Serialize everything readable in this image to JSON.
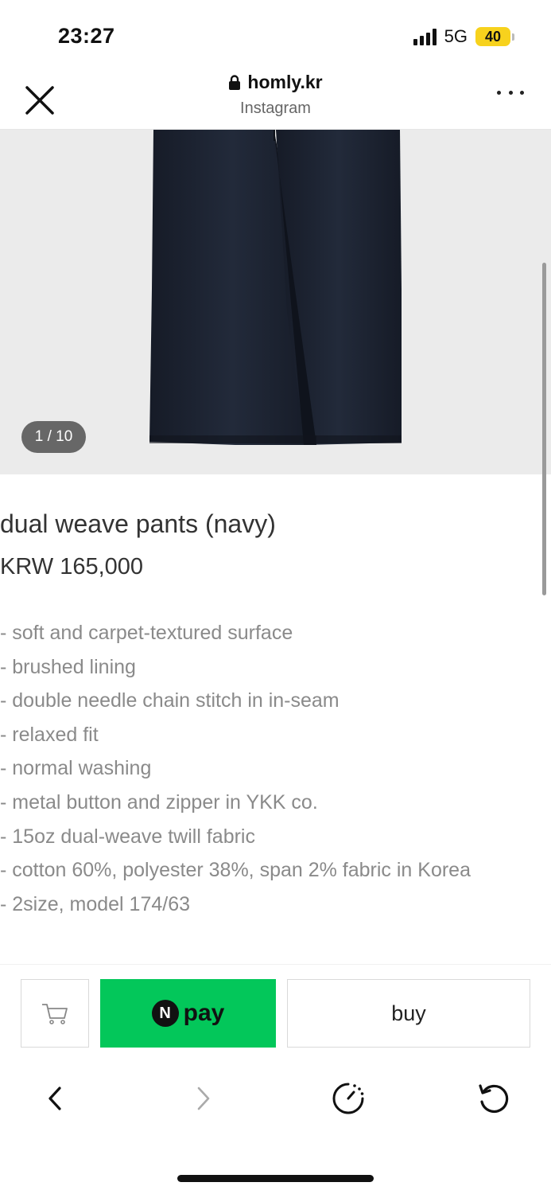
{
  "status": {
    "time": "23:27",
    "network": "5G",
    "battery": "40"
  },
  "browser": {
    "domain": "homly.kr",
    "subtitle": "Instagram",
    "close_icon": "close-icon",
    "more_icon": "more-dots-icon",
    "lock_icon": "lock-icon"
  },
  "product": {
    "image_counter": "1 / 10",
    "name": "dual weave pants (navy)",
    "price": "KRW 165,000",
    "features": [
      "- soft and carpet-textured surface",
      "- brushed lining",
      "- double needle chain stitch in in-seam",
      "- relaxed fit",
      "- normal washing",
      "- metal button and zipper in YKK co.",
      "- 15oz dual-weave twill fabric",
      "- cotton 60%, polyester 38%, span 2% fabric in Korea",
      "- 2size, model 174/63"
    ]
  },
  "purchase": {
    "cart_icon": "cart-icon",
    "npay_logo": "N",
    "npay_label": "pay",
    "buy_label": "buy"
  },
  "nav": {
    "back_icon": "chevron-left-icon",
    "forward_icon": "chevron-right-icon",
    "speed_icon": "speedometer-icon",
    "reload_icon": "reload-icon"
  },
  "colors": {
    "npay_green": "#03c75a",
    "battery_yellow": "#f7d21d",
    "image_background": "#ebebeb",
    "pants_navy": "#1c2230"
  }
}
